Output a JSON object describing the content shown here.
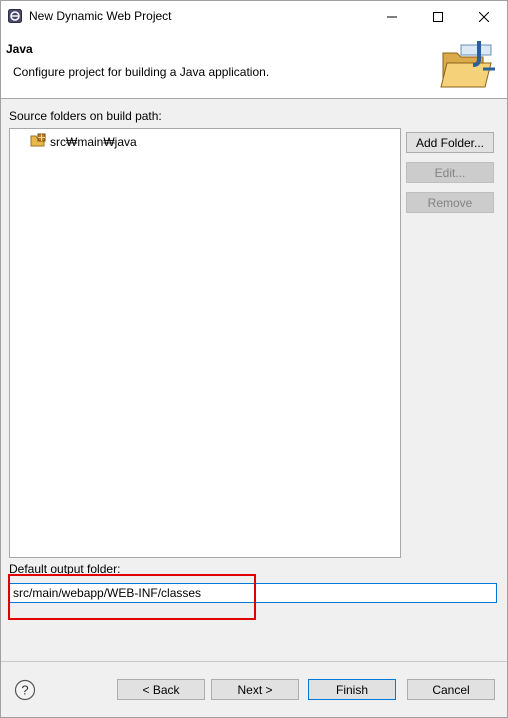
{
  "window": {
    "title": "New Dynamic Web Project",
    "controls": [
      "minimize",
      "maximize",
      "close"
    ]
  },
  "banner": {
    "title": "Java",
    "description": "Configure project for building a Java application.",
    "icon": "java-folder-icon"
  },
  "source": {
    "label": "Source folders on build path:",
    "items": [
      {
        "label": "src₩main₩java",
        "icon": "package-folder-icon"
      }
    ]
  },
  "side_buttons": {
    "add_folder": "Add Folder...",
    "edit": "Edit...",
    "remove": "Remove"
  },
  "output": {
    "label": "Default output folder:",
    "value": "src/main/webapp/WEB-INF/classes"
  },
  "footer": {
    "back": "< Back",
    "next": "Next >",
    "finish": "Finish",
    "cancel": "Cancel"
  },
  "colors": {
    "highlight": "#e00000",
    "focus": "#0078d7"
  }
}
